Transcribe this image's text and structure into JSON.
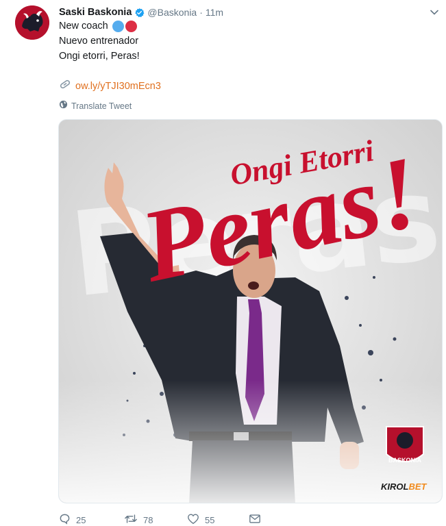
{
  "tweet": {
    "author_name": "Saski Baskonia",
    "handle": "@Baskonia",
    "separator": "·",
    "time": "11m",
    "lines": [
      "New coach",
      "Nuevo entrenador",
      "Ongi etorri, Peras!"
    ],
    "link": "ow.ly/yTJI30mEcn3",
    "translate_label": "Translate Tweet"
  },
  "media": {
    "headline_top": "Ongi Etorri",
    "headline_main": "Peras!",
    "club_logo_text": "BASKONIA",
    "sponsor_text": "KIROL",
    "sponsor_text_accent": "BET"
  },
  "actions": {
    "replies": "25",
    "retweets": "78",
    "likes": "55"
  },
  "colors": {
    "brand_red": "#b5102c",
    "link_orange": "#e0701f",
    "verified_blue": "#1da1f2",
    "muted_gray": "#657786",
    "emoji_blue": "#55acee",
    "emoji_red": "#dd2e44"
  },
  "icons": {
    "avatar": "club-crest-icon",
    "verified": "verified-badge-icon",
    "caret": "chevron-down-icon",
    "link": "link-icon",
    "translate": "globe-icon",
    "reply": "reply-icon",
    "retweet": "retweet-icon",
    "like": "heart-icon",
    "message": "envelope-icon"
  }
}
